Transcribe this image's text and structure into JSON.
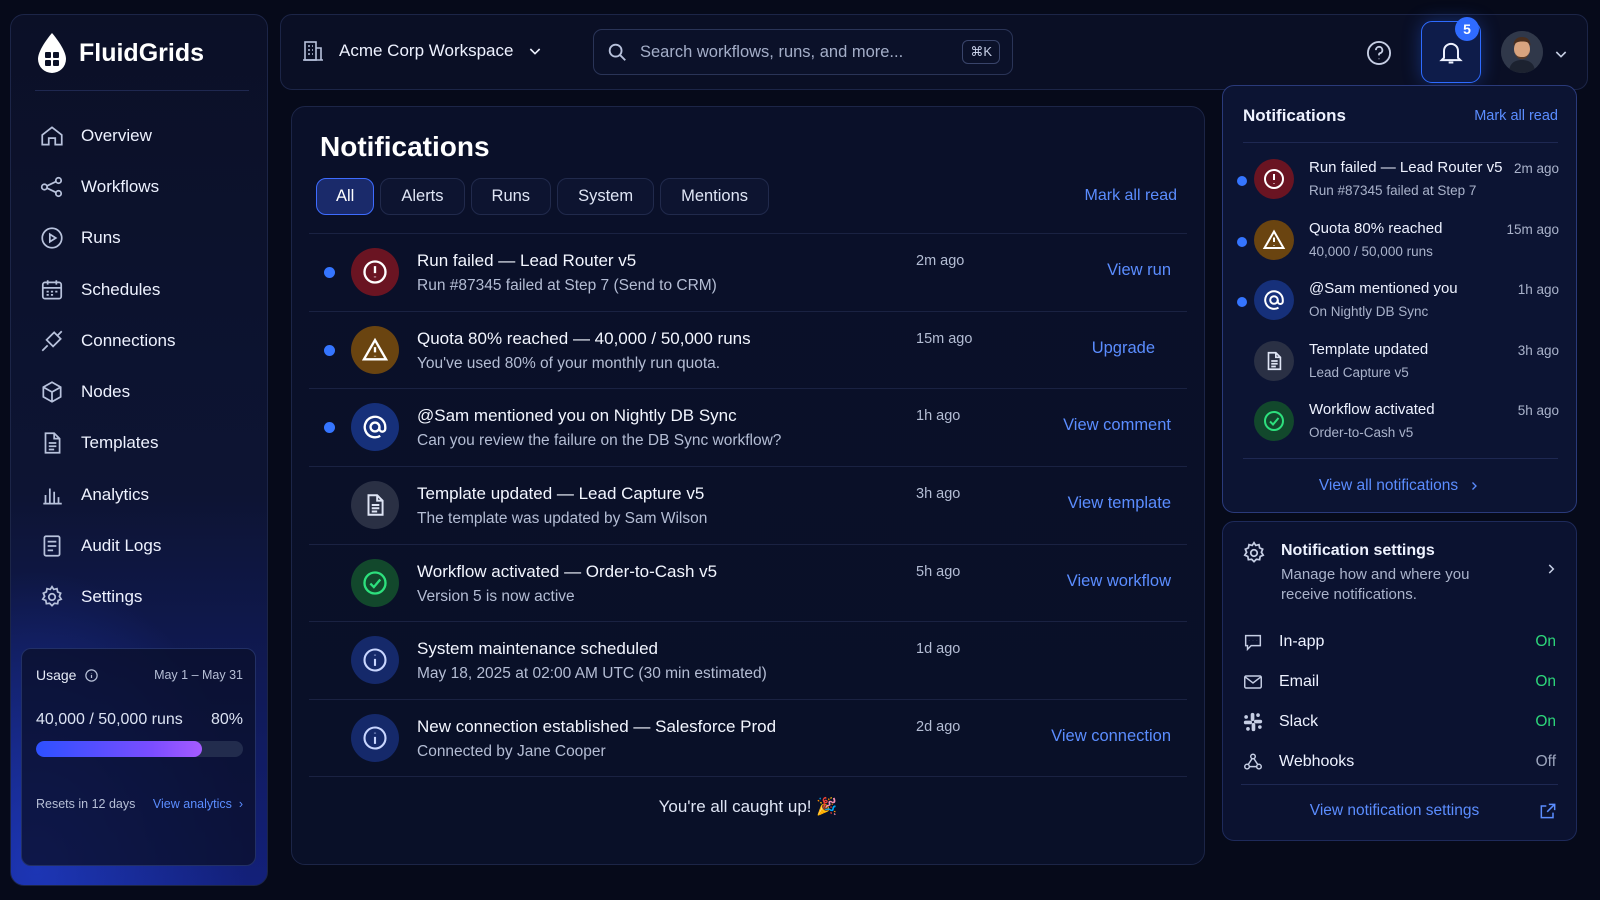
{
  "app": {
    "name": "FluidGrids"
  },
  "sidebar": {
    "items": [
      {
        "label": "Overview",
        "icon": "home-icon"
      },
      {
        "label": "Workflows",
        "icon": "workflow-icon"
      },
      {
        "label": "Runs",
        "icon": "play-circle-icon"
      },
      {
        "label": "Schedules",
        "icon": "calendar-icon"
      },
      {
        "label": "Connections",
        "icon": "plug-icon"
      },
      {
        "label": "Nodes",
        "icon": "cube-icon"
      },
      {
        "label": "Templates",
        "icon": "document-icon"
      },
      {
        "label": "Analytics",
        "icon": "bar-chart-icon"
      },
      {
        "label": "Audit Logs",
        "icon": "list-icon"
      },
      {
        "label": "Settings",
        "icon": "gear-icon"
      }
    ],
    "usage": {
      "title": "Usage",
      "period": "May 1 – May 31",
      "runs": "40,000 / 50,000 runs",
      "percent_label": "80%",
      "percent": 0.8,
      "resets": "Resets in 12 days",
      "link": "View analytics"
    }
  },
  "header": {
    "workspace": "Acme Corp Workspace",
    "search_placeholder": "Search workflows, runs, and more...",
    "shortcut": "⌘K",
    "notification_count": "5"
  },
  "main": {
    "title": "Notifications",
    "tabs": [
      "All",
      "Alerts",
      "Runs",
      "System",
      "Mentions"
    ],
    "active_tab": "All",
    "mark_all_read": "Mark all read",
    "notifications": [
      {
        "title": "Run failed — Lead Router v5",
        "subtitle": "Run #87345 failed at Step 7 (Send to CRM)",
        "time": "2m ago",
        "action": "View run",
        "unread": true,
        "type": "error"
      },
      {
        "title": "Quota 80% reached — 40,000 / 50,000 runs",
        "subtitle": "You've used 80% of your monthly run quota.",
        "time": "15m ago",
        "action": "Upgrade",
        "unread": true,
        "type": "warning"
      },
      {
        "title": "@Sam mentioned you on Nightly DB Sync",
        "subtitle": "Can you review the failure on the DB Sync workflow?",
        "time": "1h ago",
        "action": "View comment",
        "unread": true,
        "type": "mention"
      },
      {
        "title": "Template updated — Lead Capture v5",
        "subtitle": "The template was updated by Sam Wilson",
        "time": "3h ago",
        "action": "View template",
        "unread": false,
        "type": "document"
      },
      {
        "title": "Workflow activated — Order-to-Cash v5",
        "subtitle": "Version 5 is now active",
        "time": "5h ago",
        "action": "View workflow",
        "unread": false,
        "type": "success"
      },
      {
        "title": "System maintenance scheduled",
        "subtitle": "May 18, 2025 at 02:00 AM UTC (30 min estimated)",
        "time": "1d ago",
        "action": "",
        "unread": false,
        "type": "info"
      },
      {
        "title": "New connection established — Salesforce Prod",
        "subtitle": "Connected by Jane Cooper",
        "time": "2d ago",
        "action": "View connection",
        "unread": false,
        "type": "info"
      }
    ],
    "caught_up": "You're all caught up! 🎉"
  },
  "dropdown": {
    "title": "Notifications",
    "mark_all_read": "Mark all read",
    "items": [
      {
        "title": "Run failed — Lead Router v5",
        "subtitle": "Run #87345 failed at Step 7",
        "time": "2m ago",
        "unread": true,
        "type": "error"
      },
      {
        "title": "Quota 80% reached",
        "subtitle": "40,000 / 50,000 runs",
        "time": "15m ago",
        "unread": true,
        "type": "warning"
      },
      {
        "title": "@Sam mentioned you",
        "subtitle": "On Nightly DB Sync",
        "time": "1h ago",
        "unread": true,
        "type": "mention"
      },
      {
        "title": "Template updated",
        "subtitle": "Lead Capture v5",
        "time": "3h ago",
        "unread": false,
        "type": "document"
      },
      {
        "title": "Workflow activated",
        "subtitle": "Order-to-Cash v5",
        "time": "5h ago",
        "unread": false,
        "type": "success"
      }
    ],
    "view_all": "View all notifications"
  },
  "settings_panel": {
    "title": "Notification settings",
    "description": "Manage how and where you receive notifications.",
    "channels": [
      {
        "name": "In-app",
        "state": "On",
        "icon": "chat-icon"
      },
      {
        "name": "Email",
        "state": "On",
        "icon": "mail-icon"
      },
      {
        "name": "Slack",
        "state": "On",
        "icon": "slack-icon"
      },
      {
        "name": "Webhooks",
        "state": "Off",
        "icon": "webhook-icon"
      }
    ],
    "footer_link": "View notification settings"
  },
  "colors": {
    "accent": "#2f6bff",
    "link": "#5b8dff",
    "on": "#2dd67a",
    "error": "#6a1422",
    "warning": "#6a4410",
    "success": "#12482c"
  }
}
